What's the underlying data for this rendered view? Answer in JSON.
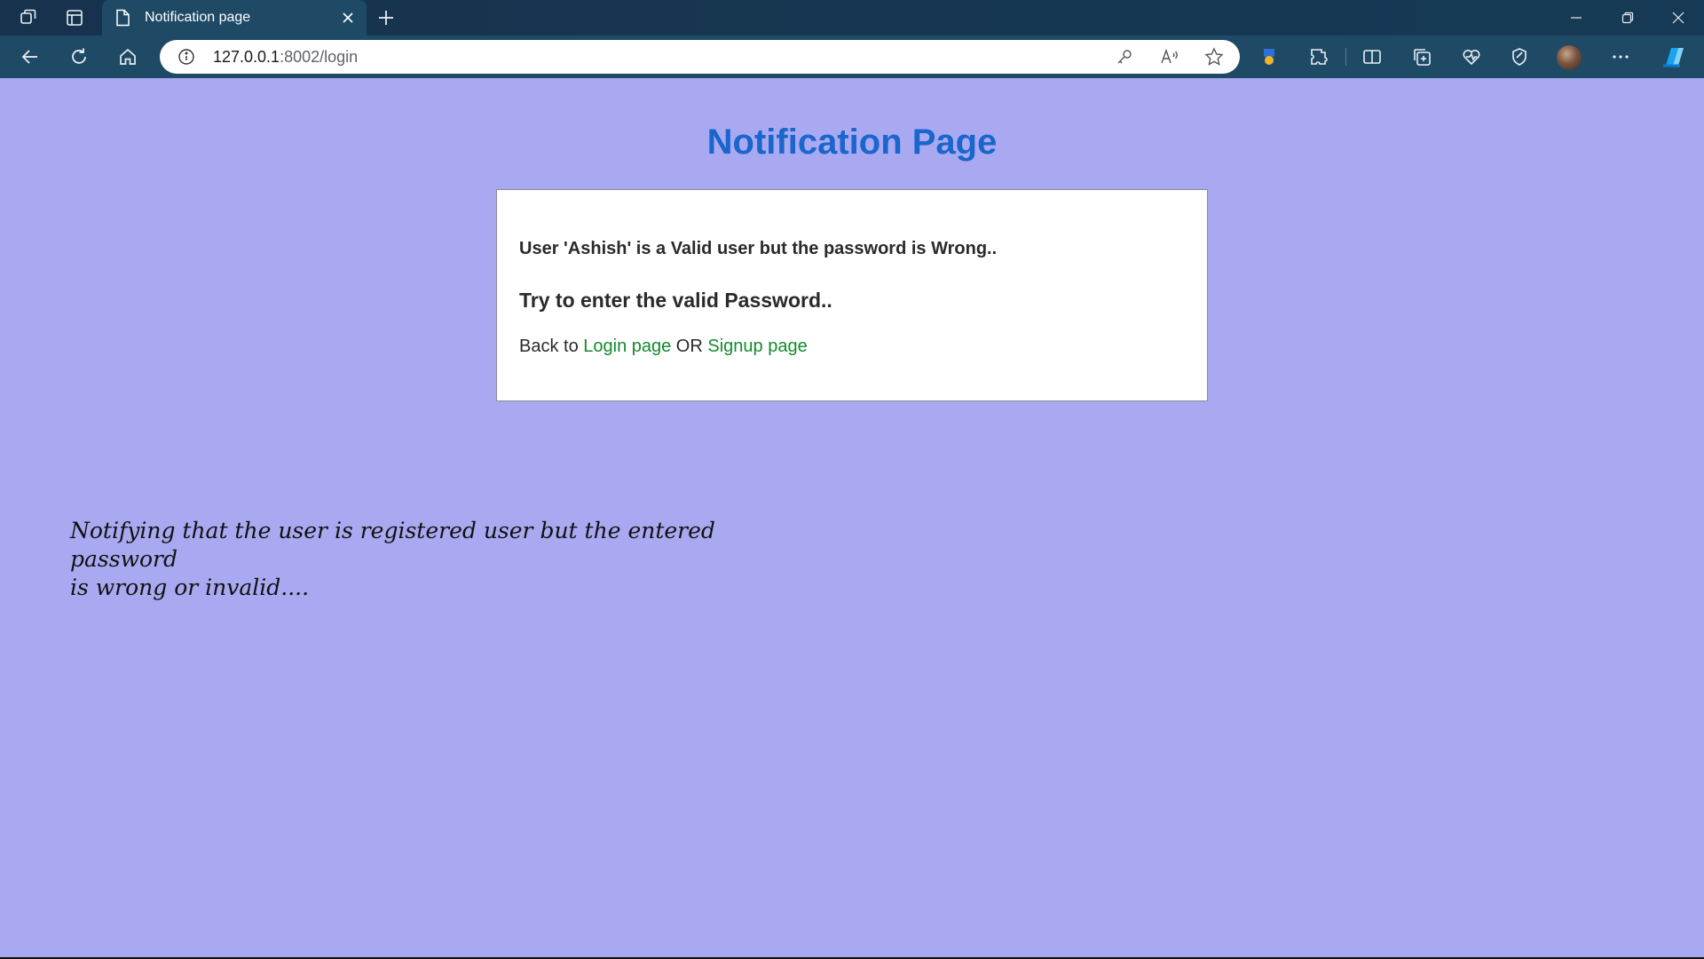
{
  "browser": {
    "tab": {
      "title": "Notification page"
    },
    "address": {
      "host": "127.0.0.1",
      "path": ":8002/login"
    }
  },
  "page": {
    "title": "Notification Page",
    "message_user": "User 'Ashish' is a Valid user but the password is Wrong..",
    "message_retry": "Try to enter the valid Password..",
    "back_prefix": "Back to ",
    "login_link": "Login page",
    "or_text": " OR ",
    "signup_link": "Signup page"
  },
  "caption": {
    "line1": "Notifying that the user is registered user but the entered password",
    "line2": "is wrong or invalid...."
  },
  "colors": {
    "background": "#a9a9f2",
    "title": "#1a66cc",
    "link": "#138a2c",
    "chrome": "#1f4a66"
  },
  "icons": [
    "workspaces-icon",
    "tab-actions-icon",
    "page-icon",
    "close-icon",
    "new-tab-icon",
    "minimize-icon",
    "restore-icon",
    "back-icon",
    "refresh-icon",
    "home-icon",
    "info-icon",
    "key-icon",
    "read-aloud-icon",
    "favorite-star-icon",
    "extension-badge-icon",
    "extensions-icon",
    "split-screen-icon",
    "collections-icon",
    "browser-essentials-icon",
    "feedback-icon",
    "avatar",
    "more-icon",
    "copilot-icon"
  ]
}
